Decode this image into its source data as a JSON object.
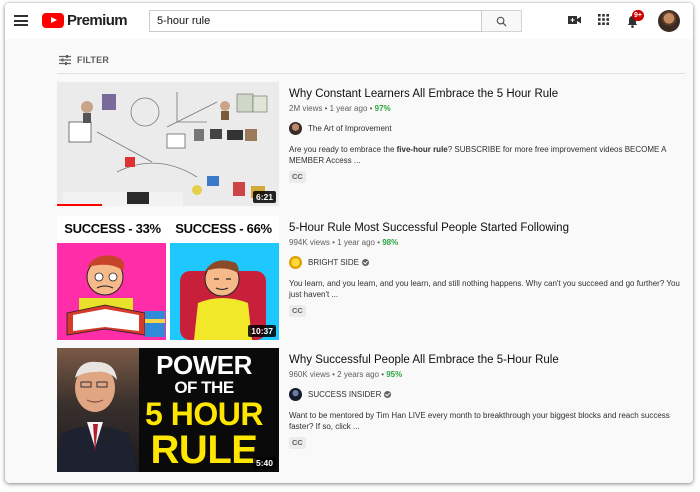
{
  "header": {
    "logo_text": "Premium",
    "search_value": "5-hour rule",
    "notification_count": "9+"
  },
  "filter": {
    "label": "FILTER"
  },
  "results": [
    {
      "title": "Why Constant Learners All Embrace the 5 Hour Rule",
      "views": "2M views",
      "age": "1 year ago",
      "rating": "97%",
      "channel": "The Art of Improvement",
      "verified": false,
      "desc_before": "Are you ready to embrace the ",
      "desc_bold": "five-hour rule",
      "desc_after": "? SUBSCRIBE for more free improvement videos BECOME A MEMBER Access ...",
      "badge": "CC",
      "duration": "6:21"
    },
    {
      "title": "5-Hour Rule Most Successful People Started Following",
      "views": "994K views",
      "age": "1 year ago",
      "rating": "98%",
      "channel": "BRIGHT SIDE",
      "verified": true,
      "desc": "You learn, and you learn, and you learn, and still nothing happens. Why can't you succeed and go further? You just haven't ...",
      "badge": "CC",
      "duration": "10:37",
      "thumb_left_text": "SUCCESS - 33%",
      "thumb_right_text": "SUCCESS - 66%"
    },
    {
      "title": "Why Successful People All Embrace the 5-Hour Rule",
      "views": "960K views",
      "age": "2 years ago",
      "rating": "95%",
      "channel": "SUCCESS INSIDER",
      "verified": true,
      "desc": "Want to be mentored by Tim Han LIVE every month to breakthrough your biggest blocks and reach success faster? If so, click ...",
      "badge": "CC",
      "duration": "5:40",
      "thumb_lines": [
        "POWER",
        "OF THE",
        "5 HOUR",
        "RULE"
      ]
    }
  ],
  "colors": {
    "brand_red": "#ff0000",
    "rating_green": "#2ba640",
    "thumb2_left": "#ff2ea8",
    "thumb2_right": "#1ec8ff",
    "thumb3_yellow": "#ffe600"
  }
}
